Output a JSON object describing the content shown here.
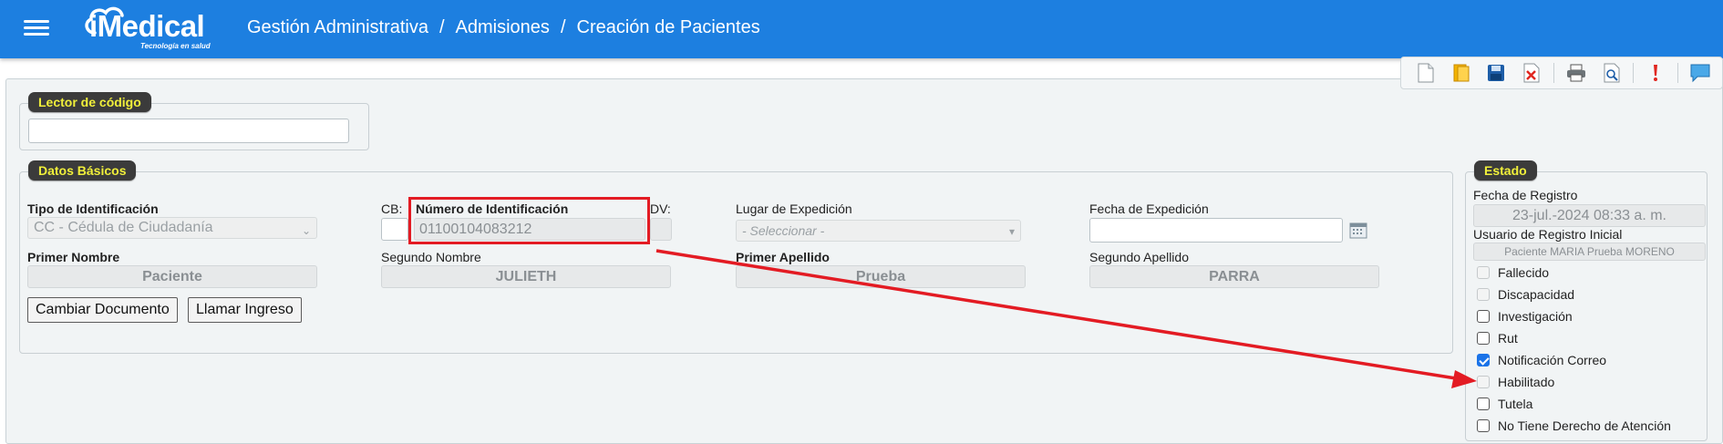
{
  "header": {
    "logo_text": "iMedical",
    "logo_tagline": "Tecnología en salud",
    "breadcrumb": [
      "Gestión Administrativa",
      "Admisiones",
      "Creación de Pacientes"
    ],
    "separator": "/"
  },
  "toolbar": {
    "buttons": [
      "new-document-icon",
      "open-folder-icon",
      "save-icon",
      "delete-icon",
      "print-icon",
      "preview-icon",
      "alert-icon",
      "chat-icon"
    ]
  },
  "lector": {
    "legend": "Lector de código",
    "value": ""
  },
  "datos_basicos": {
    "legend": "Datos Básicos",
    "tipo_identificacion": {
      "label": "Tipo de Identificación",
      "value": "CC - Cédula de Ciudadanía"
    },
    "cb": {
      "label": "CB:",
      "value": ""
    },
    "numero_identificacion": {
      "label": "Número de Identificación",
      "value": "01100104083212"
    },
    "dv": {
      "label": "DV:",
      "value": ""
    },
    "lugar_expedicion": {
      "label": "Lugar de Expedición",
      "value": "- Seleccionar -"
    },
    "fecha_expedicion": {
      "label": "Fecha de Expedición",
      "value": ""
    },
    "primer_nombre": {
      "label": "Primer Nombre",
      "value": "Paciente"
    },
    "segundo_nombre": {
      "label": "Segundo Nombre",
      "value": "JULIETH"
    },
    "primer_apellido": {
      "label": "Primer Apellido",
      "value": "Prueba"
    },
    "segundo_apellido": {
      "label": "Segundo Apellido",
      "value": "PARRA"
    },
    "buttons": {
      "cambiar": "Cambiar Documento",
      "llamar": "Llamar Ingreso"
    }
  },
  "estado": {
    "legend": "Estado",
    "fecha_registro": {
      "label": "Fecha de Registro",
      "value": "23-jul.-2024 08:33 a. m."
    },
    "usuario_registro": {
      "label": "Usuario de Registro Inicial",
      "value": "Paciente MARIA Prueba MORENO"
    },
    "checks": [
      {
        "label": "Fallecido",
        "checked": false,
        "disabled": true
      },
      {
        "label": "Discapacidad",
        "checked": false,
        "disabled": true
      },
      {
        "label": "Investigación",
        "checked": false,
        "disabled": false
      },
      {
        "label": "Rut",
        "checked": false,
        "disabled": false
      },
      {
        "label": "Notificación Correo",
        "checked": true,
        "disabled": false
      },
      {
        "label": "Habilitado",
        "checked": false,
        "disabled": true
      },
      {
        "label": "Tutela",
        "checked": false,
        "disabled": false
      },
      {
        "label": "No Tiene Derecho de Atención",
        "checked": false,
        "disabled": false
      }
    ]
  },
  "colors": {
    "header_bg": "#1d7fe0",
    "legend_bg": "#3b3b3b",
    "legend_text": "#f0ef3a",
    "annotation_red": "#e31b23",
    "checkbox_checked": "#1a73e8"
  }
}
